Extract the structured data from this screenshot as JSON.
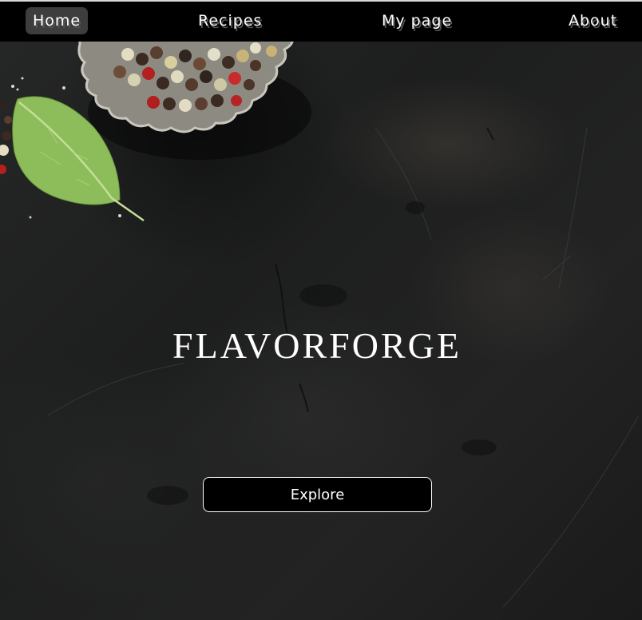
{
  "nav": {
    "items": [
      {
        "label": "Home",
        "active": true
      },
      {
        "label": "Recipes",
        "active": false
      },
      {
        "label": "My page",
        "active": false
      },
      {
        "label": "About",
        "active": false
      }
    ]
  },
  "hero": {
    "title": "FLAVORFORGE",
    "cta_label": "Explore",
    "background_image": "dark slate surface with peppercorn bowl and basil leaf"
  },
  "colors": {
    "navbar_bg": "#000000",
    "active_tab_bg": "#3d3d3d",
    "text": "#ffffff",
    "button_bg": "#000000",
    "button_border": "#ffffff"
  }
}
